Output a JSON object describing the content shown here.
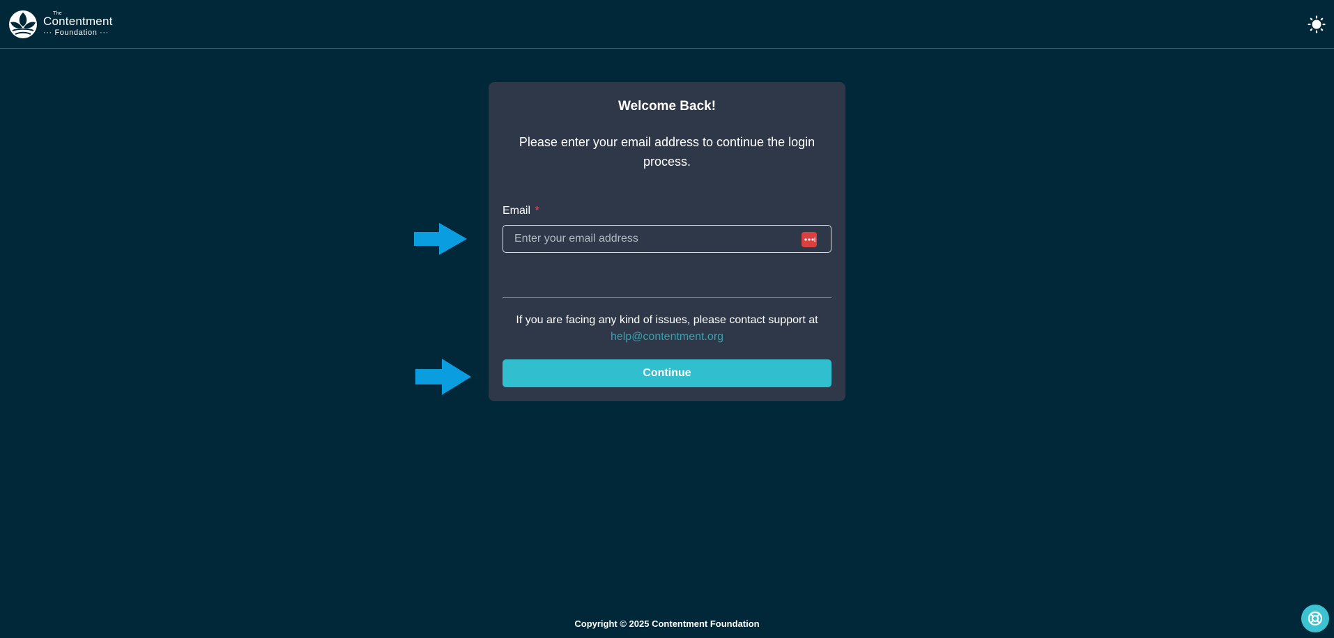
{
  "header": {
    "logo": {
      "the": "The",
      "name": "Contentment",
      "sub": "··· Foundation ···"
    },
    "theme_toggle_icon": "sun-icon"
  },
  "card": {
    "title": "Welcome Back!",
    "description": "Please enter your email address to continue the login process.",
    "email": {
      "label": "Email",
      "required_mark": "*",
      "placeholder": "Enter your email address",
      "value": "",
      "trailing_icon": "password-manager-icon"
    },
    "support": {
      "text": "If you are facing any kind of issues, please contact support at",
      "email": "help@contentment.org"
    },
    "continue_label": "Continue"
  },
  "annotations": {
    "arrow_icon": "arrow-right-icon",
    "arrow_color": "#0a9ee0"
  },
  "footer": {
    "copyright": "Copyright © 2025 Contentment Foundation"
  },
  "help_widget_icon": "lifebuoy-icon",
  "colors": {
    "background": "#002838",
    "card": "#2f3848",
    "accent": "#31bfcf",
    "link": "#3aa0b0",
    "required": "#e0566b"
  }
}
